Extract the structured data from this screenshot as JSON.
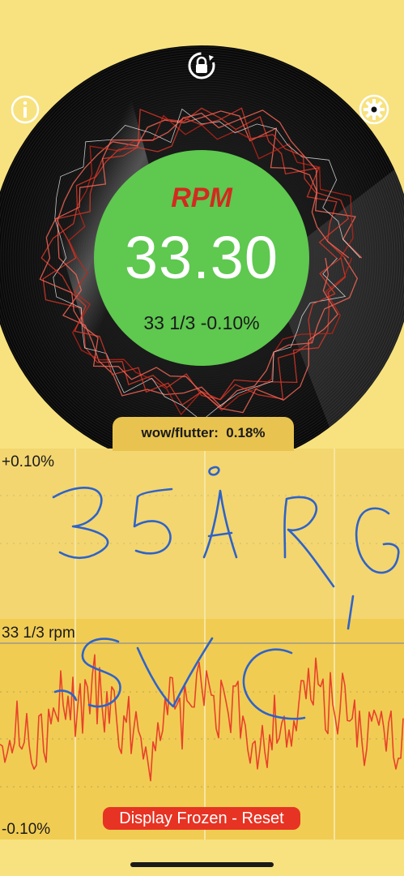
{
  "rpm": {
    "title": "RPM",
    "value": "33.30",
    "target_deviation": "33 1/3 -0.10%",
    "status_color": "#5ec84f"
  },
  "wow_flutter": {
    "label": "wow/flutter:  0.18%"
  },
  "graph": {
    "top_label": "+0.10%",
    "center_label": "33 1/3 rpm",
    "bottom_label": "-0.10%",
    "trace_color": "#e8412a"
  },
  "controls": {
    "freeze_reset_label": "Display Frozen - Reset",
    "icons": [
      "lock-rotate-icon",
      "info-icon",
      "gear-icon"
    ]
  },
  "colors": {
    "background": "#f7e27f",
    "graph_panel": "#f1cc53",
    "record": "#111111",
    "accent_red": "#e73323"
  }
}
